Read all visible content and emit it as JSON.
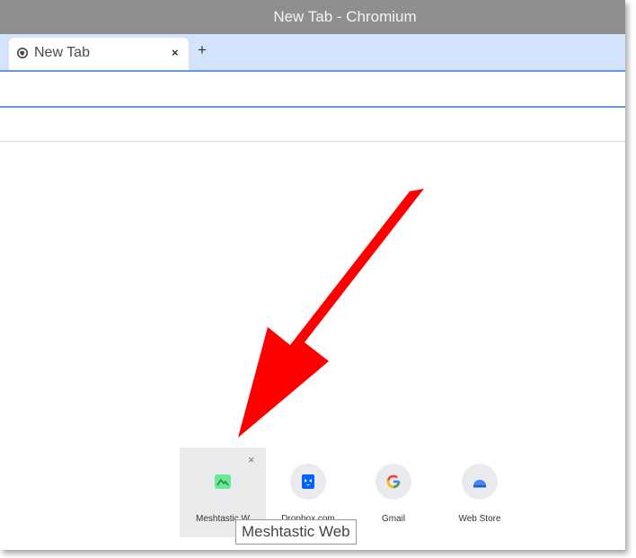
{
  "window": {
    "title": "New Tab - Chromium"
  },
  "tabs": [
    {
      "label": "New Tab",
      "favicon": "globe-icon",
      "close_label": "×"
    }
  ],
  "new_tab_button": "+",
  "annotation": {
    "arrow_color": "#ff0000"
  },
  "shortcuts": [
    {
      "label": "Meshtastic W",
      "icon": "meshtastic-icon",
      "color": "#67ea94",
      "remove_label": "×"
    },
    {
      "label": "Dropbox.com",
      "icon": "dropbox-icon",
      "color": "#0061fe"
    },
    {
      "label": "Gmail",
      "icon": "google-g-icon"
    },
    {
      "label": "Web Store",
      "icon": "web-store-icon",
      "color": "#4285f4"
    }
  ],
  "tooltip": {
    "text": "Meshtastic Web"
  },
  "colors": {
    "titlebar": "#8f8f8f",
    "tabstrip": "#d3e3fc",
    "omnibox_border": "#6a97df"
  }
}
